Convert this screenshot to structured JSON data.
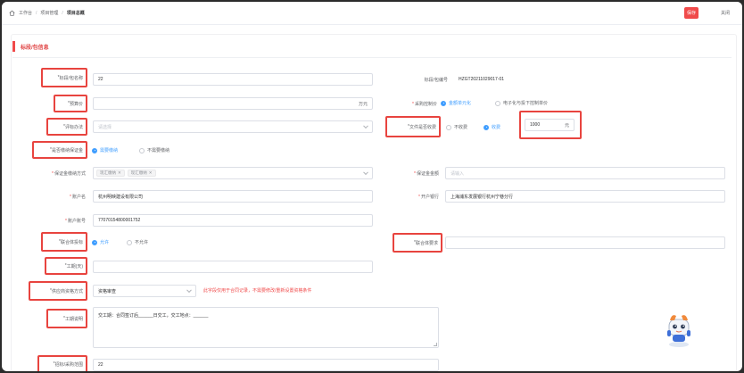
{
  "header": {
    "breadcrumb": [
      "工作台",
      "项目管理",
      "项目总概"
    ],
    "save_label": "保存",
    "close_label": "关闭"
  },
  "section": {
    "title": "标段/包信息"
  },
  "form": {
    "bid_name": {
      "label": "标段/包名称",
      "value": "22"
    },
    "bid_code": {
      "label": "标段/包编号",
      "value": "HZGT20211029017-01"
    },
    "budget": {
      "label": "预算价",
      "value": "",
      "suffix": "万元"
    },
    "price_control": {
      "label": "采购控制价",
      "option_selected": "金额单元化",
      "option_other": "电子化与投下控制单价"
    },
    "eval_method": {
      "label": "评标办法",
      "placeholder": "请选择"
    },
    "bid_doc_fee": {
      "label": "文件是否收费",
      "option_no": "不收费",
      "option_yes": "收费",
      "amount": "1000",
      "amount_suffix": "元"
    },
    "deposit": {
      "label": "是否缴纳保证金",
      "option_selected": "需要缴纳",
      "option_other": "不需要缴纳"
    },
    "deposit_method": {
      "label": "保证金缴纳方式",
      "tags": [
        "现汇缴纳",
        "现汇缴纳"
      ]
    },
    "deposit_amount": {
      "label": "保证金金额",
      "placeholder": "请输入"
    },
    "account_name": {
      "label": "账户名",
      "value": "杭州明映建设有限公司"
    },
    "bank": {
      "label": "开户银行",
      "value": "上海浦东发展银行杭州宁巷分行"
    },
    "account_no": {
      "label": "账户账号",
      "value": "77070154800001752"
    },
    "joint_bid": {
      "label": "联合体投标",
      "option_selected": "允许",
      "option_other": "不允许"
    },
    "joint_requirement": {
      "label": "联合体要求",
      "value": ""
    },
    "duration": {
      "label": "工期(天)",
      "value": ""
    },
    "review_method": {
      "label": "供应商资格方式",
      "value": "资格审查",
      "warning": "此字段仅用于合同记录，不需要修改/重新设置资格条件"
    },
    "work_time": {
      "label": "工期说明",
      "value": "交工期：合同签订后______日交工，交工地点：______"
    },
    "scope": {
      "label": "招标/采购范围",
      "value": "22"
    }
  }
}
